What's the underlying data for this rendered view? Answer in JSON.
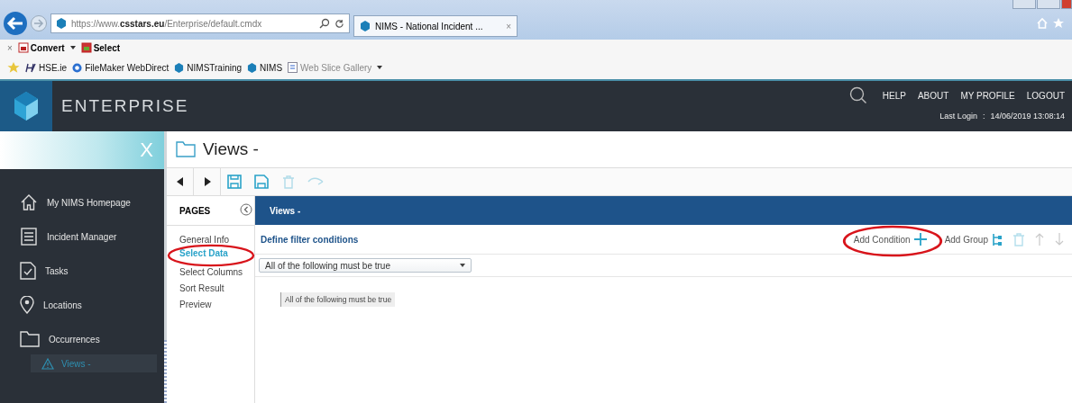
{
  "browser": {
    "url_prefix": "https://www.",
    "url_domain": "csstars.eu",
    "url_path": "/Enterprise/default.cmdx",
    "tab_title": "NIMS - National Incident ...",
    "tab_close": "×",
    "command_close": "×",
    "command_bar": [
      "Convert",
      "Select"
    ],
    "favorites": [
      "HSE.ie",
      "FileMaker WebDirect",
      "NIMSTraining",
      "NIMS",
      "Web Slice Gallery"
    ]
  },
  "header": {
    "app_name": "ENTERPRISE",
    "links": [
      "HELP",
      "ABOUT",
      "MY PROFILE",
      "LOGOUT"
    ],
    "last_login_label": "Last Login",
    "last_login_separator": ":",
    "last_login_value": "14/06/2019 13:08:14"
  },
  "sidebar": {
    "close": "X",
    "items": [
      {
        "label": "My NIMS Homepage",
        "kind": "home",
        "selected": false
      },
      {
        "label": "Incident Manager",
        "kind": "list",
        "selected": false
      },
      {
        "label": "Tasks",
        "kind": "task",
        "selected": false
      },
      {
        "label": "Locations",
        "kind": "pin",
        "selected": false
      },
      {
        "label": "Occurrences",
        "kind": "folder",
        "selected": false,
        "children": [
          {
            "label": "Views -",
            "kind": "warning",
            "selected": true
          }
        ]
      }
    ]
  },
  "page": {
    "title": "Views -",
    "toolbar": [
      {
        "kind": "prev",
        "disabled": false
      },
      {
        "kind": "next",
        "disabled": false
      },
      {
        "kind": "save",
        "disabled": false
      },
      {
        "kind": "saveas",
        "disabled": false
      },
      {
        "kind": "trash",
        "disabled": true
      },
      {
        "kind": "undo",
        "disabled": true
      }
    ],
    "pages_heading": "PAGES",
    "pages": [
      {
        "label": "General Info",
        "selected": false,
        "circled": false
      },
      {
        "label": "Select Data",
        "selected": true,
        "circled": true
      },
      {
        "label": "Select Columns",
        "selected": false,
        "circled": false
      },
      {
        "label": "Sort Result",
        "selected": false,
        "circled": false
      },
      {
        "label": "Preview",
        "selected": false,
        "circled": false
      }
    ],
    "panel_title": "Views -",
    "section_title": "Define filter conditions",
    "actions": [
      {
        "label": "Add Condition",
        "kind": "plus",
        "disabled": false,
        "circled": true
      },
      {
        "label": "Add Group",
        "kind": "tree",
        "disabled": false,
        "circled": false
      },
      {
        "kind": "trash",
        "disabled": true,
        "circled": false
      },
      {
        "kind": "up",
        "disabled": true,
        "circled": false
      },
      {
        "kind": "down",
        "disabled": true,
        "circled": false
      }
    ],
    "filter_mode": "All of the following must be true",
    "condition_root": "All of the following must be true"
  }
}
